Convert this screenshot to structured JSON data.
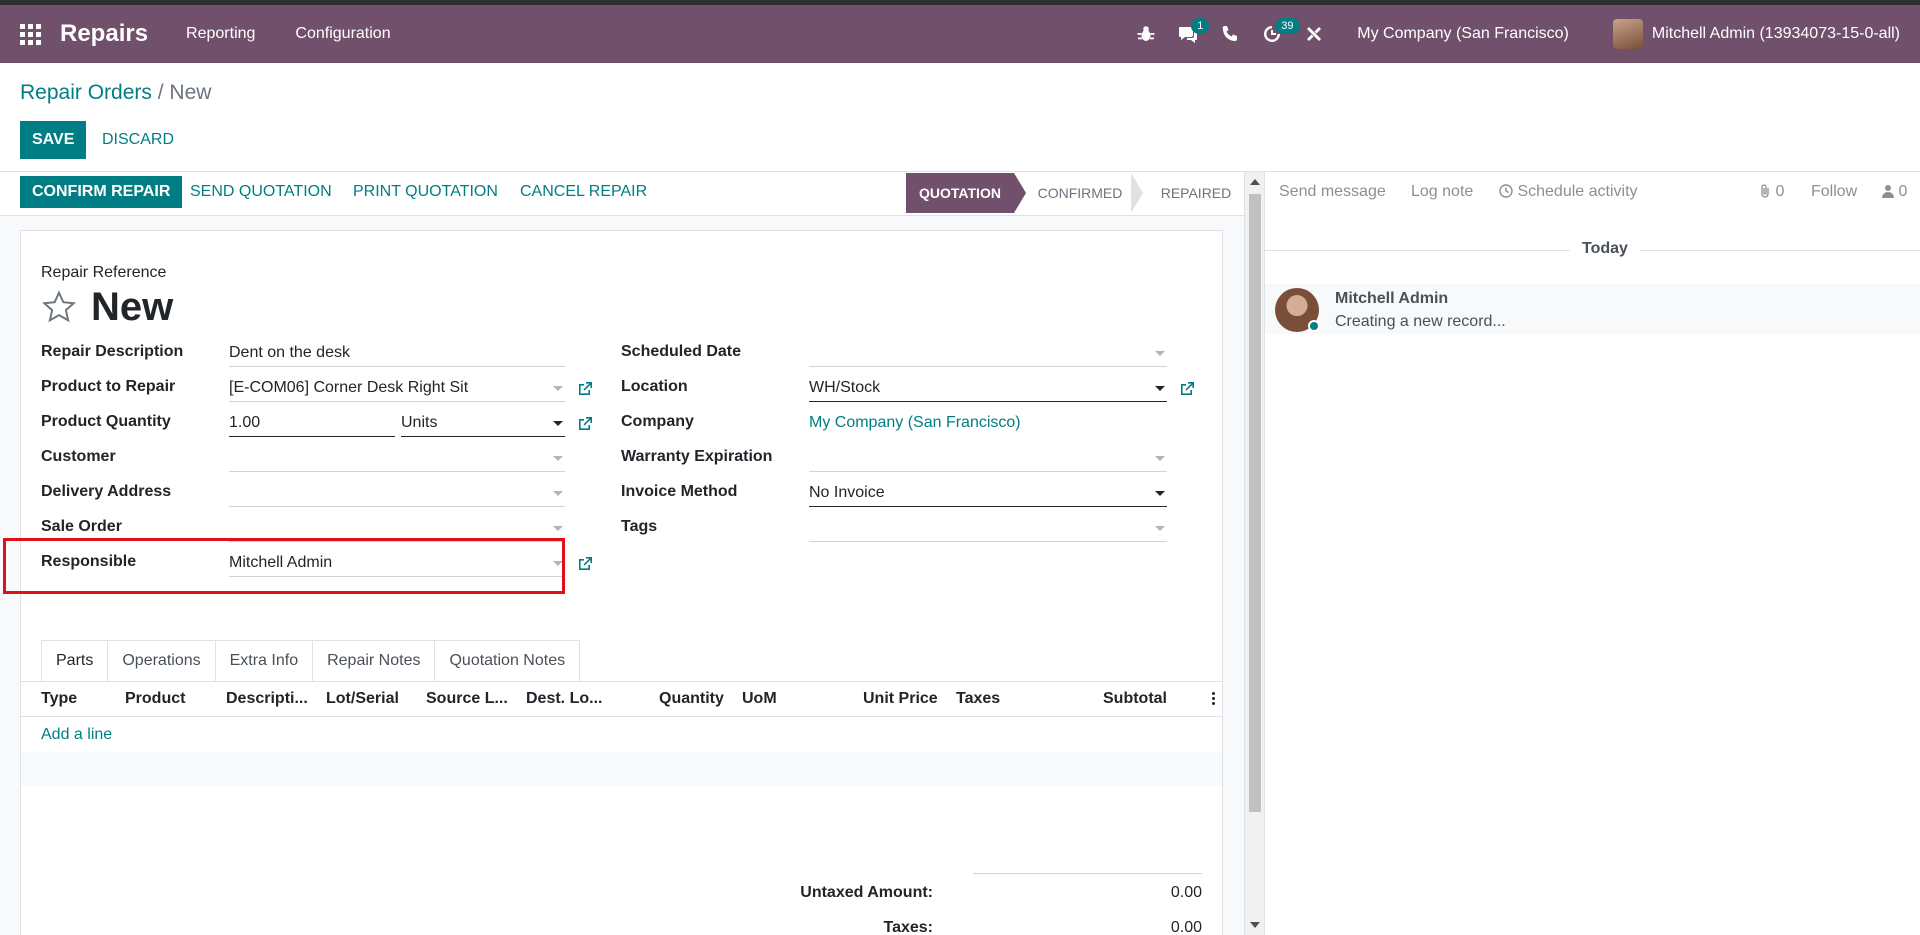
{
  "navbar": {
    "app_name": "Repairs",
    "menus": [
      "Reporting",
      "Configuration"
    ],
    "chat_count": "1",
    "activity_count": "39",
    "company": "My Company (San Francisco)",
    "user": "Mitchell Admin (13934073-15-0-all)",
    "bg_color": "#71506b"
  },
  "breadcrumb": {
    "parent": "Repair Orders",
    "separator": "/",
    "current": "New"
  },
  "actions": {
    "save": "SAVE",
    "discard": "DISCARD"
  },
  "statusbar": {
    "buttons": [
      "CONFIRM REPAIR",
      "SEND QUOTATION",
      "PRINT QUOTATION",
      "CANCEL REPAIR"
    ],
    "stages": [
      "QUOTATION",
      "CONFIRMED",
      "REPAIRED"
    ],
    "active_stage": "QUOTATION"
  },
  "form": {
    "ref_label": "Repair Reference",
    "ref_value": "New",
    "left": {
      "description_label": "Repair Description",
      "description_value": "Dent on the desk",
      "product_label": "Product to Repair",
      "product_value": "[E-COM06] Corner Desk Right Sit",
      "qty_label": "Product Quantity",
      "qty_value": "1.00",
      "uom_value": "Units",
      "customer_label": "Customer",
      "delivery_label": "Delivery Address",
      "sale_order_label": "Sale Order",
      "responsible_label": "Responsible",
      "responsible_value": "Mitchell Admin"
    },
    "right": {
      "scheduled_label": "Scheduled Date",
      "location_label": "Location",
      "location_value": "WH/Stock",
      "company_label": "Company",
      "company_value": "My Company (San Francisco)",
      "warranty_label": "Warranty Expiration",
      "invoice_label": "Invoice Method",
      "invoice_value": "No Invoice",
      "tags_label": "Tags"
    }
  },
  "tabs": [
    "Parts",
    "Operations",
    "Extra Info",
    "Repair Notes",
    "Quotation Notes"
  ],
  "parts_table": {
    "columns": [
      "Type",
      "Product",
      "Descripti...",
      "Lot/Serial",
      "Source L...",
      "Dest. Lo...",
      "Quantity",
      "UoM",
      "Unit Price",
      "Taxes",
      "Subtotal"
    ],
    "add_line": "Add a line"
  },
  "totals": {
    "untaxed_label": "Untaxed Amount:",
    "untaxed_value": "0.00",
    "taxes_label": "Taxes:",
    "taxes_value": "0.00"
  },
  "chatter": {
    "send_message": "Send message",
    "log_note": "Log note",
    "schedule_activity": "Schedule activity",
    "attachments": "0",
    "follow": "Follow",
    "followers": "0",
    "day": "Today",
    "message_author": "Mitchell Admin",
    "message_body": "Creating a new record..."
  }
}
